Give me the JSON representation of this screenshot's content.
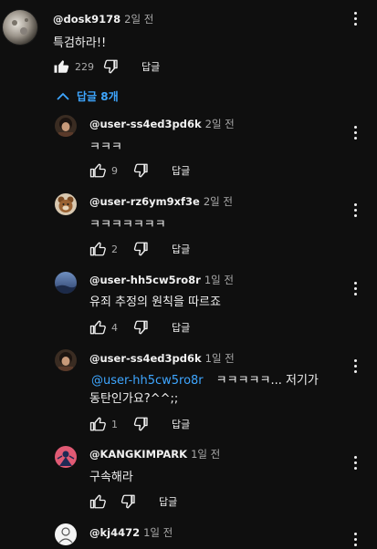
{
  "top_comment": {
    "handle": "@dosk9178",
    "time": "2일 전",
    "text": "특검하라!!",
    "likes": "229",
    "reply_label": "답글"
  },
  "replies_toggle": {
    "label": "답글 8개",
    "icon": "chevron-up-icon"
  },
  "replies": [
    {
      "handle": "@user-ss4ed3pd6k",
      "time": "2일 전",
      "text": "ㅋㅋㅋ",
      "likes": "9",
      "reply_label": "답글"
    },
    {
      "handle": "@user-rz6ym9xf3e",
      "time": "2일 전",
      "text": "ㅋㅋㅋㅋㅋㅋㅋ",
      "likes": "2",
      "reply_label": "답글"
    },
    {
      "handle": "@user-hh5cw5ro8r",
      "time": "1일 전",
      "text": "유죄 추정의 원칙을 따르죠",
      "likes": "4",
      "reply_label": "답글"
    },
    {
      "handle": "@user-ss4ed3pd6k",
      "time": "1일 전",
      "mention": "@user-hh5cw5ro8r",
      "text_line1": "ㅋㅋㅋㅋㅋ... 저기가",
      "text_line2": "동탄인가요?^^;;",
      "likes": "1",
      "reply_label": "답글"
    },
    {
      "handle": "@KANGKIMPARK",
      "time": "1일 전",
      "text": "구속해라",
      "likes": "",
      "reply_label": "답글"
    },
    {
      "handle": "@kj4472",
      "time": "1일 전"
    }
  ],
  "colors": {
    "background": "#0f0f0f",
    "text": "#f1f1f1",
    "secondary": "#aaaaaa",
    "link": "#3ea6ff"
  }
}
